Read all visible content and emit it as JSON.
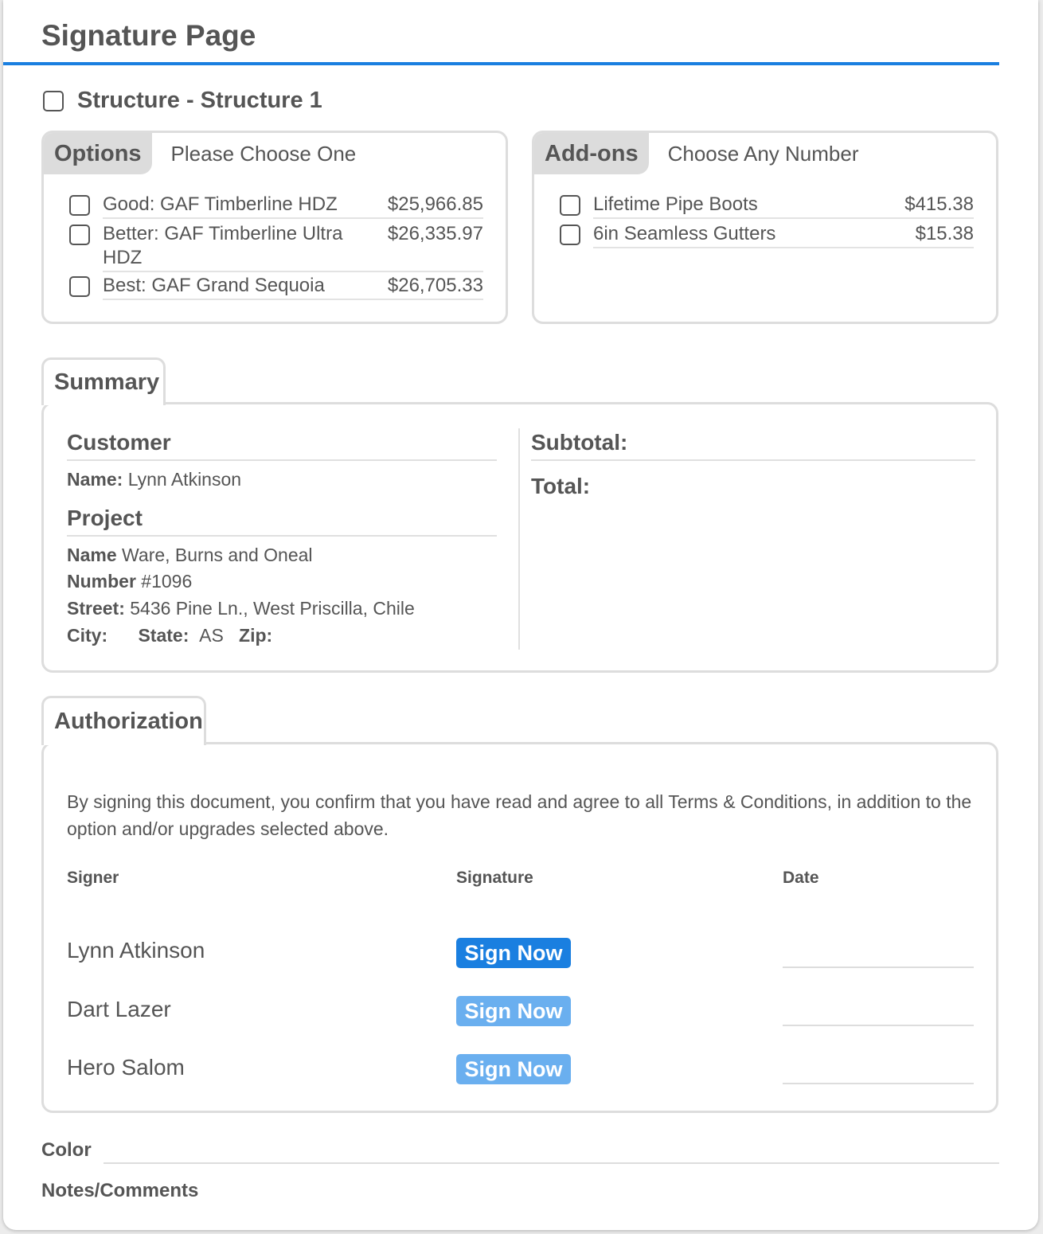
{
  "page": {
    "title": "Signature Page",
    "accent_color": "#1a7fe0"
  },
  "structure": {
    "label": "Structure - Structure 1",
    "checked": false
  },
  "options": {
    "tag": "Options",
    "subtitle": "Please Choose One",
    "items": [
      {
        "name": "Good: GAF Timberline HDZ",
        "price": "$25,966.85",
        "checked": false
      },
      {
        "name": "Better: GAF Timberline Ultra HDZ",
        "price": "$26,335.97",
        "checked": false
      },
      {
        "name": "Best: GAF Grand Sequoia",
        "price": "$26,705.33",
        "checked": false
      }
    ]
  },
  "addons": {
    "tag": "Add-ons",
    "subtitle": "Choose Any Number",
    "items": [
      {
        "name": "Lifetime Pipe Boots",
        "price": "$415.38",
        "checked": false
      },
      {
        "name": "6in Seamless Gutters",
        "price": "$15.38",
        "checked": false
      }
    ]
  },
  "summary": {
    "tab": "Summary",
    "customer": {
      "heading": "Customer",
      "name_label": "Name:",
      "name_value": "Lynn Atkinson"
    },
    "project": {
      "heading": "Project",
      "name_label": "Name",
      "name_value": "Ware, Burns and Oneal",
      "number_label": "Number",
      "number_value": "#1096",
      "street_label": "Street:",
      "street_value": "5436 Pine Ln., West Priscilla, Chile",
      "city_label": "City:",
      "city_value": "",
      "state_label": "State:",
      "state_value": "AS",
      "zip_label": "Zip:",
      "zip_value": ""
    },
    "subtotal_label": "Subtotal:",
    "total_label": "Total:"
  },
  "authorization": {
    "tab": "Authorization",
    "text": "By signing this document, you confirm that you have read and agree to all Terms & Conditions, in addition to the option and/or upgrades selected above.",
    "col_signer": "Signer",
    "col_signature": "Signature",
    "col_date": "Date",
    "signers": [
      {
        "name": "Lynn Atkinson",
        "button": "Sign Now",
        "button_color": "#1a7fe0"
      },
      {
        "name": "Dart Lazer",
        "button": "Sign Now",
        "button_color": "#6aafef"
      },
      {
        "name": "Hero Salom",
        "button": "Sign Now",
        "button_color": "#6aafef"
      }
    ]
  },
  "footer": {
    "color_label": "Color",
    "notes_label": "Notes/Comments"
  }
}
